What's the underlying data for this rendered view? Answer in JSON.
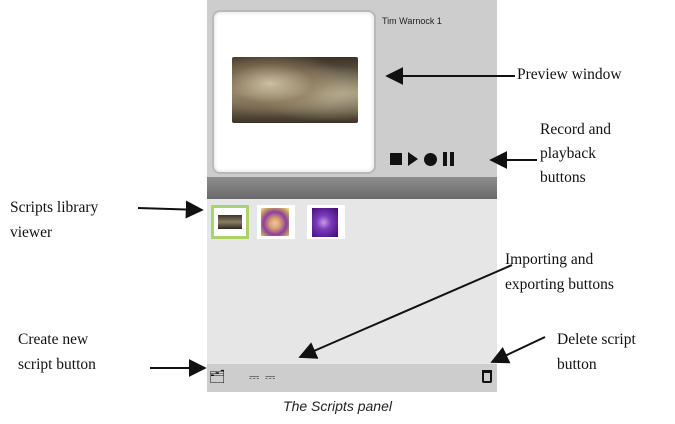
{
  "panel": {
    "user_name": "Tim Warnock 1",
    "controls": [
      "stop-icon",
      "play-icon",
      "record-icon",
      "pause-icon"
    ],
    "library_thumbnails": [
      "photo-thumbnail",
      "purple-art-thumbnail",
      "violet-art-thumbnail"
    ],
    "bottom_icons": [
      "create-script-icon",
      "import-icon",
      "export-icon",
      "trash-icon"
    ]
  },
  "callouts": {
    "preview_window": "Preview window",
    "record_playback": [
      "Record and",
      "playback",
      "buttons"
    ],
    "scripts_library": [
      "Scripts library",
      "viewer"
    ],
    "import_export": [
      "Importing and",
      "exporting buttons"
    ],
    "create_new": [
      "Create new",
      "script button"
    ],
    "delete_script": [
      "Delete script",
      "button"
    ]
  },
  "caption": "The Scripts panel",
  "colors": {
    "panel_bg": "#e6e6e6",
    "preview_bg": "#cdcdcd",
    "header_bar": "#7a7a7a",
    "selection": "#a9d46a"
  }
}
